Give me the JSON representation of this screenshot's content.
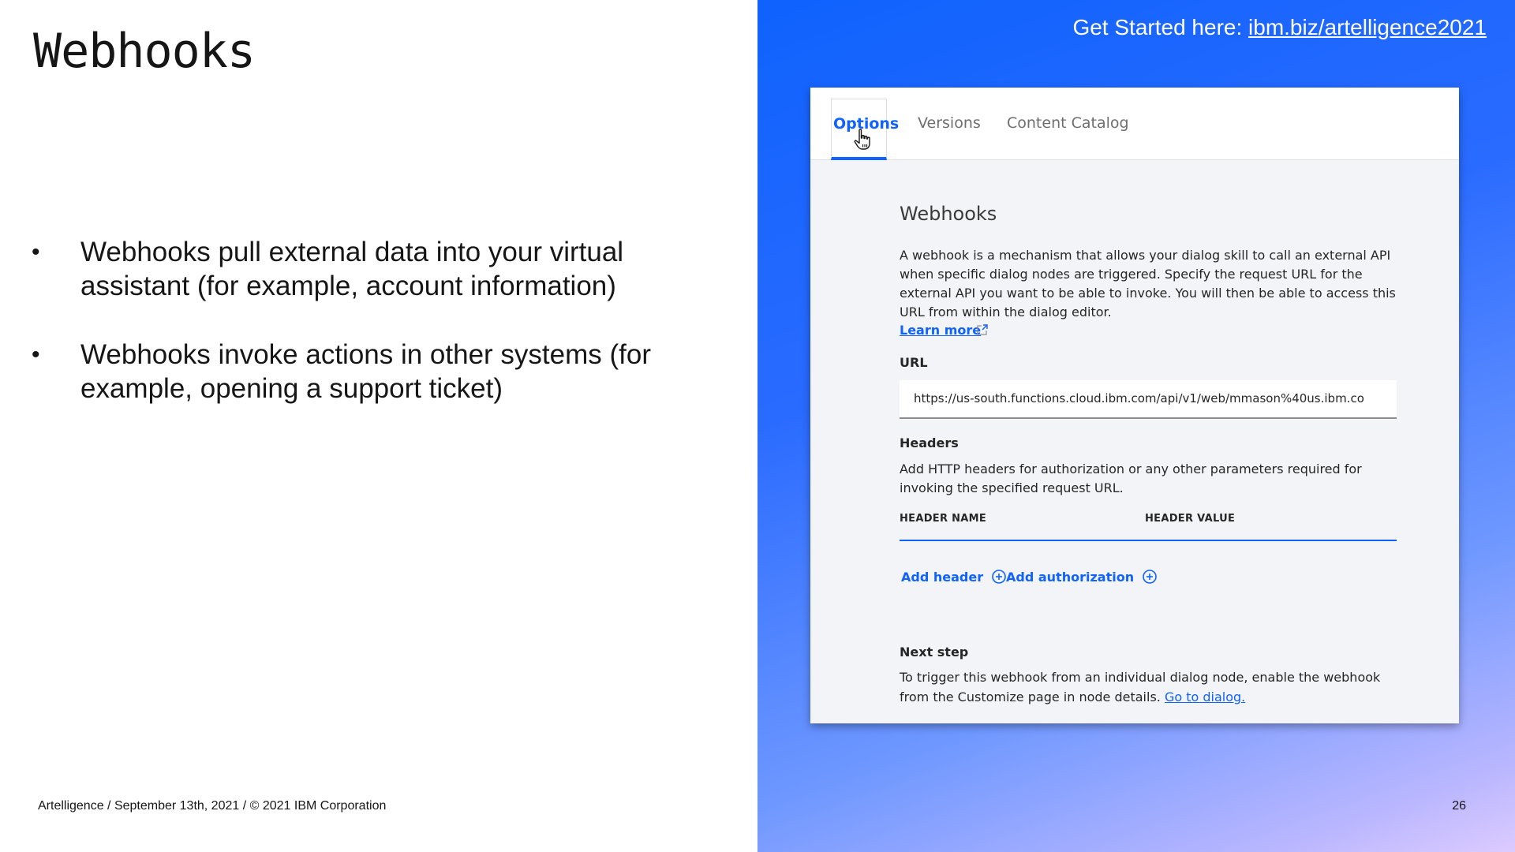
{
  "slide": {
    "title": "Webhooks",
    "bullets": [
      "Webhooks pull external data into your virtual assistant (for example, account information)",
      "Webhooks invoke actions in other systems (for example, opening a support ticket)"
    ],
    "bullet_symbol": "•",
    "footer": "Artelligence / September 13th, 2021 / © 2021 IBM Corporation",
    "page_number": "26",
    "get_started_prefix": "Get Started here: ",
    "get_started_link": "ibm.biz/artelligence2021"
  },
  "screenshot": {
    "tabs": [
      {
        "label": "Options",
        "active": true
      },
      {
        "label": "Versions",
        "active": false
      },
      {
        "label": "Content Catalog",
        "active": false
      }
    ],
    "heading": "Webhooks",
    "description": "A webhook is a mechanism that allows your dialog skill to call an external API when specific dialog nodes are triggered. Specify the request URL for the external API you want to be able to invoke. You will then be able to access this URL from within the dialog editor.",
    "learn_more": "Learn more",
    "url_label": "URL",
    "url_value": "https://us-south.functions.cloud.ibm.com/api/v1/web/mmason%40us.ibm.co",
    "headers_label": "Headers",
    "headers_description": "Add HTTP headers for authorization or any other parameters required for invoking the specified request URL.",
    "header_name_col": "HEADER NAME",
    "header_value_col": "HEADER VALUE",
    "add_header": "Add header",
    "add_authorization": "Add authorization",
    "next_step_label": "Next step",
    "next_step_text": "To trigger this webhook from an individual dialog node, enable the webhook from the Customize page in node details. ",
    "go_to_dialog": "Go to dialog."
  },
  "icons": {
    "cursor": "hand-pointer-icon",
    "external_link": "launch-icon",
    "add": "add-circle-icon"
  },
  "colors": {
    "accent": "#0f62fe",
    "panel_gradient_start": "#0f62fe",
    "panel_gradient_end": "#dccbff"
  }
}
